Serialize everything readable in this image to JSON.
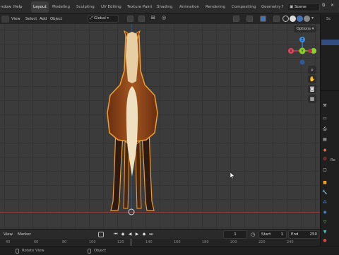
{
  "topbar": {
    "menus": [
      "ndow",
      "Help"
    ],
    "workspaces": [
      "Layout",
      "Modeling",
      "Sculpting",
      "UV Editing",
      "Texture Paint",
      "Shading",
      "Animation",
      "Rendering",
      "Compositing",
      "Geometry N"
    ],
    "scene_label": "Scene"
  },
  "viewport_header": {
    "menus": [
      "View",
      "Select",
      "Add",
      "Object"
    ],
    "transform_orientation": "Global",
    "options_label": "Options"
  },
  "gizmo": {
    "x": "X",
    "y": "Y",
    "z": "Z"
  },
  "properties": {
    "truncated_label_1": "Sc",
    "truncated_label_2": "Ro"
  },
  "timeline": {
    "menus": [
      "View",
      "Marker"
    ],
    "current_frame": "1",
    "start_label": "Start",
    "start_value": "1",
    "end_label": "End",
    "end_value": "250"
  },
  "ruler_numbers": [
    "40",
    "60",
    "80",
    "100",
    "120",
    "140",
    "160",
    "180",
    "200",
    "220",
    "240"
  ],
  "status": {
    "left_action": "Rotate View",
    "middle_action": "Object"
  },
  "colors": {
    "selection": "#f0a030",
    "x_axis": "#e0465e",
    "y_axis": "#8ed12c",
    "z_axis": "#3f8fe8",
    "accent": "#4772b3"
  }
}
